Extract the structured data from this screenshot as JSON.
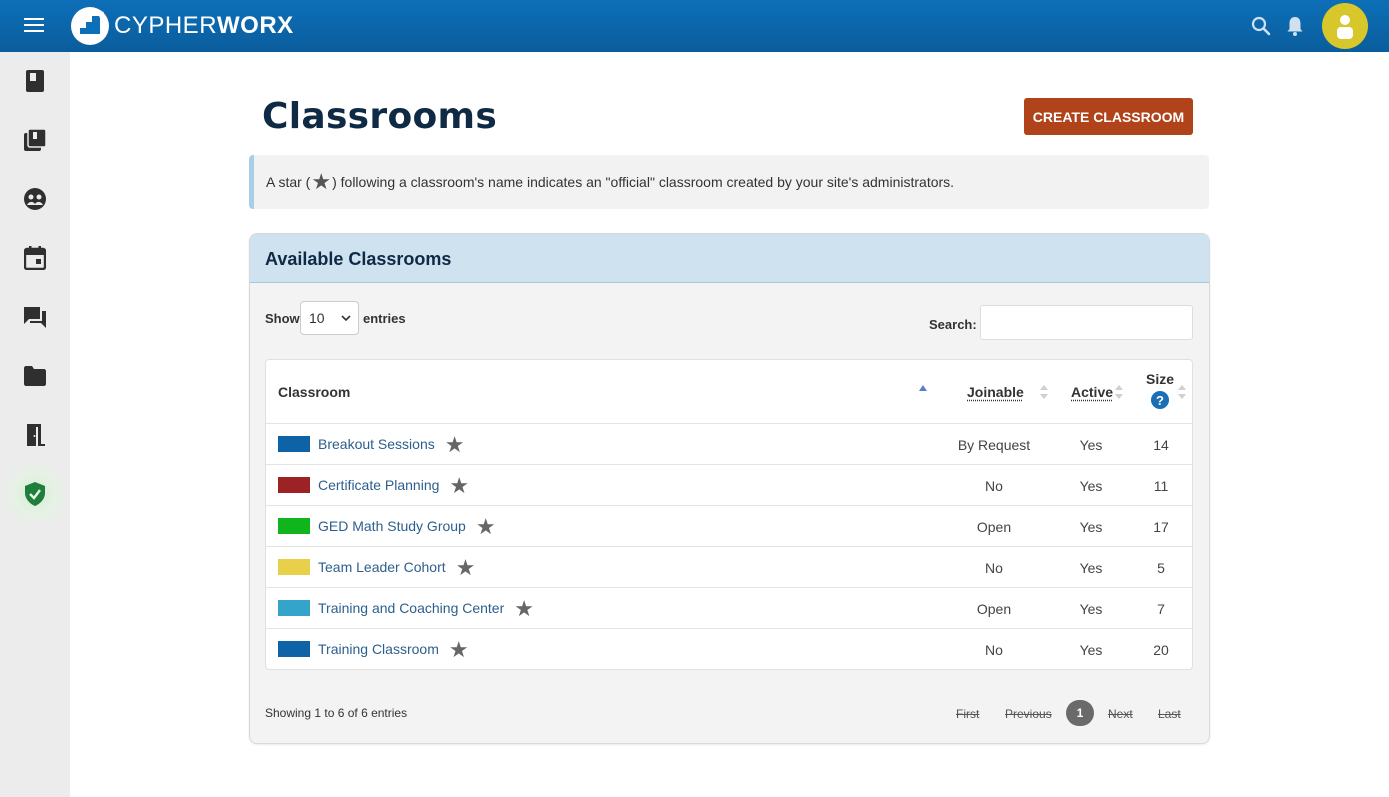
{
  "header": {
    "logo_light": "CYPHER",
    "logo_bold": "WORX",
    "menu_icon": "menu-icon",
    "search_icon": "search-icon",
    "bell_icon": "bell-icon",
    "avatar_icon": "user-icon",
    "brand_color": "#0d6fb8",
    "avatar_color": "#d8c72a"
  },
  "sidebar": {
    "items": [
      {
        "icon": "book-icon"
      },
      {
        "icon": "library-icon"
      },
      {
        "icon": "community-icon"
      },
      {
        "icon": "calendar-icon"
      },
      {
        "icon": "chat-icon"
      },
      {
        "icon": "folder-icon"
      },
      {
        "icon": "exit-door-icon"
      },
      {
        "icon": "shield-check-icon",
        "active": true
      }
    ]
  },
  "page": {
    "title": "Classrooms",
    "create_button": "CREATE CLASSROOM",
    "note_before": "A star (",
    "note_star": "★",
    "note_after": ") following a classroom's name indicates an \"official\" classroom created by your site's administrators."
  },
  "panel": {
    "title": "Available Classrooms",
    "show_label": "Show",
    "show_value": "10",
    "entries_label": "entries",
    "search_label": "Search:",
    "search_value": "",
    "columns": {
      "classroom": "Classroom",
      "joinable": "Joinable",
      "active": "Active",
      "size": "Size",
      "size_help": "?"
    },
    "rows": [
      {
        "name": "Breakout Sessions",
        "color": "#0e63a7",
        "joinable": "By Request",
        "active": "Yes",
        "size": "14",
        "star": "★"
      },
      {
        "name": "Certificate Planning",
        "color": "#9c2226",
        "joinable": "No",
        "active": "Yes",
        "size": "11",
        "star": "★"
      },
      {
        "name": "GED Math Study Group",
        "color": "#10b51e",
        "joinable": "Open",
        "active": "Yes",
        "size": "17",
        "star": "★"
      },
      {
        "name": "Team Leader Cohort",
        "color": "#e8d04a",
        "joinable": "No",
        "active": "Yes",
        "size": "5",
        "star": "★"
      },
      {
        "name": "Training and Coaching Center",
        "color": "#34a5c9",
        "joinable": "Open",
        "active": "Yes",
        "size": "7",
        "star": "★"
      },
      {
        "name": "Training Classroom",
        "color": "#0e63a7",
        "joinable": "No",
        "active": "Yes",
        "size": "20",
        "star": "★"
      }
    ],
    "showing": "Showing 1 to 6 of 6 entries",
    "pagination": {
      "first": "First",
      "previous": "Previous",
      "current": "1",
      "next": "Next",
      "last": "Last"
    }
  }
}
